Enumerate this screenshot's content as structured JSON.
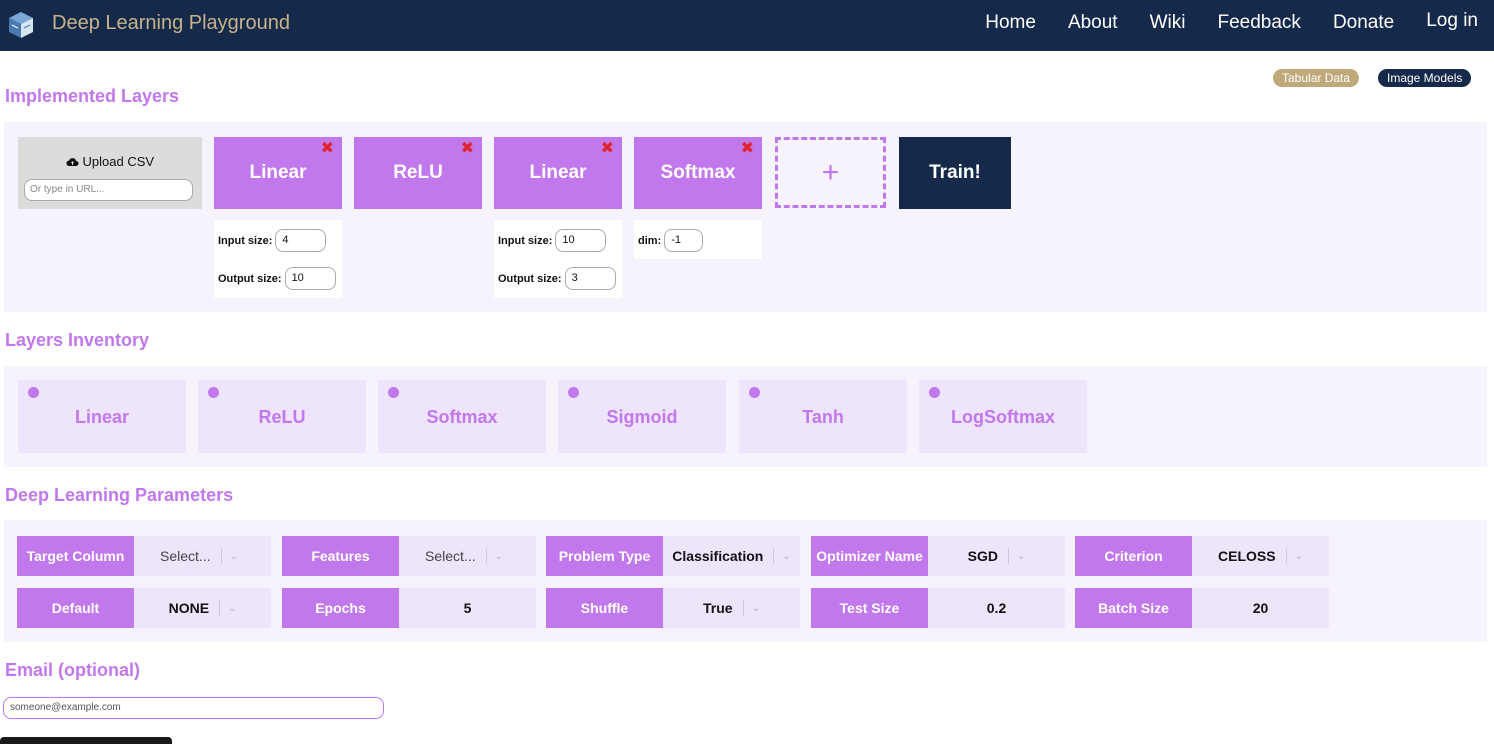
{
  "navbar": {
    "brand": "Deep Learning Playground",
    "logo_icon": "cube-logo-icon",
    "links": [
      "Home",
      "About",
      "Wiki",
      "Feedback",
      "Donate",
      "Log in"
    ]
  },
  "mode_badges": {
    "tabular": "Tabular Data",
    "image": "Image Models"
  },
  "implemented": {
    "title": "Implemented Layers",
    "upload_label": "Upload CSV",
    "url_placeholder": "Or type in URL...",
    "layers": [
      "Linear",
      "ReLU",
      "Linear",
      "Softmax"
    ],
    "remove_glyph": "✖",
    "add_glyph": "+",
    "train_label": "Train!",
    "params": {
      "l1_input_label": "Input size:",
      "l1_input": "4",
      "l1_output_label": "Output size:",
      "l1_output": "10",
      "l3_input_label": "Input size:",
      "l3_input": "10",
      "l3_output_label": "Output size:",
      "l3_output": "3",
      "softmax_dim_label": "dim:",
      "softmax_dim": "-1"
    }
  },
  "inventory": {
    "title": "Layers Inventory",
    "items": [
      "Linear",
      "ReLU",
      "Softmax",
      "Sigmoid",
      "Tanh",
      "LogSoftmax"
    ]
  },
  "params": {
    "title": "Deep Learning Parameters",
    "row1": [
      {
        "label": "Target Column",
        "value": "Select..."
      },
      {
        "label": "Features",
        "value": "Select..."
      },
      {
        "label": "Problem Type",
        "value": "Classification"
      },
      {
        "label": "Optimizer Name",
        "value": "SGD"
      },
      {
        "label": "Criterion",
        "value": "CELOSS"
      }
    ],
    "row2": [
      {
        "label": "Default",
        "value": "NONE"
      },
      {
        "label": "Epochs",
        "value": "5"
      },
      {
        "label": "Shuffle",
        "value": "True"
      },
      {
        "label": "Test Size",
        "value": "0.2"
      },
      {
        "label": "Batch Size",
        "value": "20"
      }
    ]
  },
  "email": {
    "title": "Email (optional)",
    "placeholder": "someone@example.com"
  },
  "colors": {
    "navy": "#15294a",
    "purple": "#c278ed",
    "gold": "#c8b38a",
    "remove_red": "#e0242f"
  }
}
